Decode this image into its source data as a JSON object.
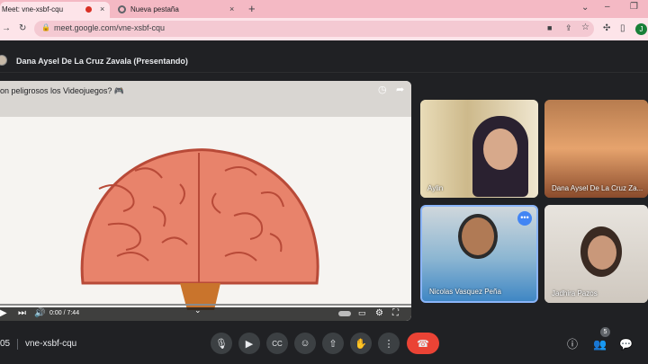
{
  "tabs": [
    {
      "title": "Meet: vne-xsbf-cqu",
      "close": "×"
    },
    {
      "title": "Nueva pestaña",
      "close": "×"
    }
  ],
  "new_tab": "+",
  "address": {
    "url": "meet.google.com/vne-xsbf-cqu"
  },
  "presenter": {
    "label": "Dana Aysel De La Cruz Zavala (Presentando)"
  },
  "video": {
    "title": "on peligrosos los Videojuegos? 🎮",
    "time": "0:00 / 7:44",
    "progress": 0.0
  },
  "participants": [
    {
      "name": "Aylin"
    },
    {
      "name": "Dana Aysel De La Cruz Za..."
    },
    {
      "name": "Nicolas Vasquez Peña"
    },
    {
      "name": "Jadhira Pazos"
    }
  ],
  "meeting": {
    "time": "05",
    "code": "vne-xsbf-cqu",
    "participant_count": "5"
  },
  "colors": {
    "tabbar": "#f4b9c4",
    "meet_bg": "#202124",
    "hangup": "#ea4335",
    "active_tile_border": "#8ab4f8"
  }
}
